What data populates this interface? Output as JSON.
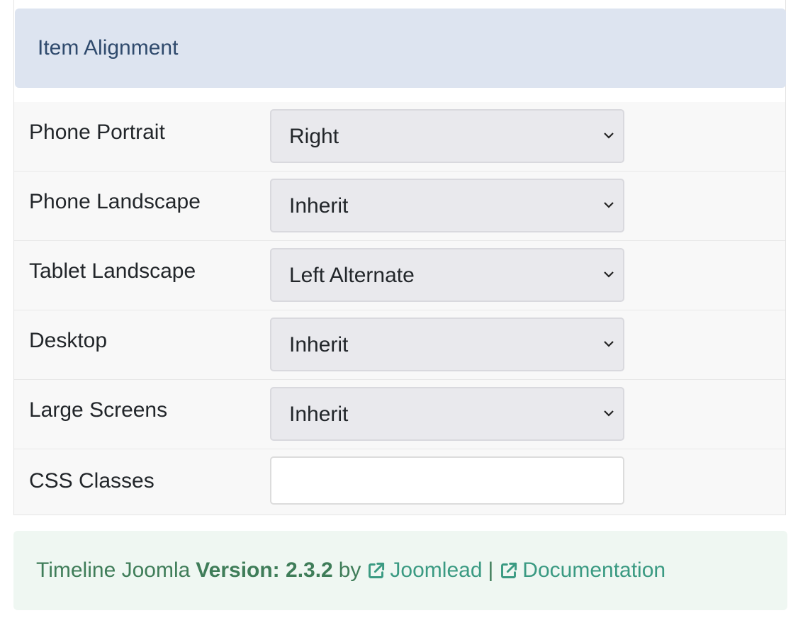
{
  "section": {
    "title": "Item Alignment"
  },
  "fields": [
    {
      "label": "Phone Portrait",
      "value": "Right"
    },
    {
      "label": "Phone Landscape",
      "value": "Inherit"
    },
    {
      "label": "Tablet Landscape",
      "value": "Left Alternate"
    },
    {
      "label": "Desktop",
      "value": "Inherit"
    },
    {
      "label": "Large Screens",
      "value": "Inherit"
    }
  ],
  "css_field": {
    "label": "CSS Classes",
    "value": ""
  },
  "footer": {
    "product": "Timeline Joomla",
    "version_label": "Version: 2.3.2",
    "by": "by",
    "link_author": "Joomlead",
    "separator": "|",
    "link_docs": "Documentation"
  },
  "icons": {
    "dropdown": "chevron-down-icon",
    "external_link": "external-link-icon"
  }
}
